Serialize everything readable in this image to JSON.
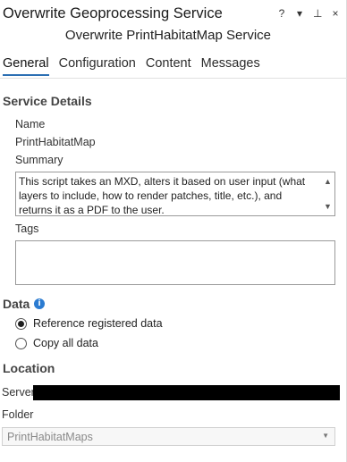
{
  "pane": {
    "title": "Overwrite Geoprocessing Service",
    "tools": {
      "help": "?",
      "menu": "▾",
      "pin": "⊥",
      "close": "×"
    },
    "subtitle": "Overwrite PrintHabitatMap Service"
  },
  "tabs": [
    {
      "label": "General",
      "active": true
    },
    {
      "label": "Configuration",
      "active": false
    },
    {
      "label": "Content",
      "active": false
    },
    {
      "label": "Messages",
      "active": false
    }
  ],
  "service_details": {
    "heading": "Service Details",
    "name_label": "Name",
    "name_value": "PrintHabitatMap",
    "summary_label": "Summary",
    "summary_value": "This script takes an MXD, alters it based on user input (what layers to include, how to render patches, title, etc.), and returns it as a PDF to the user.",
    "tags_label": "Tags",
    "tags_value": ""
  },
  "data_section": {
    "heading": "Data",
    "info_icon": "info-icon",
    "options": [
      {
        "label": "Reference registered data",
        "checked": true
      },
      {
        "label": "Copy all data",
        "checked": false
      }
    ]
  },
  "location": {
    "heading": "Location",
    "server_label": "Server:",
    "folder_label": "Folder",
    "folder_value": "PrintHabitatMaps"
  },
  "colors": {
    "accent": "#2b6fb3",
    "info": "#2b7bd1",
    "redaction": "#000000"
  }
}
